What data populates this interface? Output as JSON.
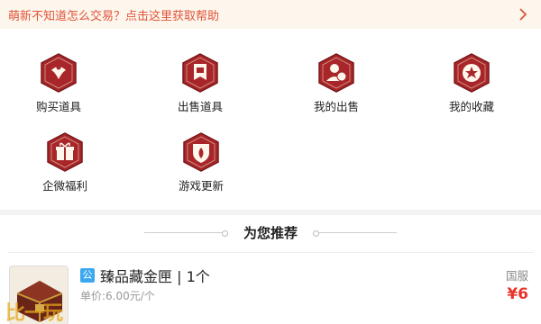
{
  "help_bar": {
    "text": "萌新不知道怎么交易？点击这里获取帮助",
    "icon": "chevron-right-icon"
  },
  "grid": {
    "items": [
      {
        "label": "购买道具",
        "icon": "buy-items-icon"
      },
      {
        "label": "出售道具",
        "icon": "sell-items-icon"
      },
      {
        "label": "我的出售",
        "icon": "my-sales-icon"
      },
      {
        "label": "我的收藏",
        "icon": "my-favorites-icon"
      },
      {
        "label": "企微福利",
        "icon": "gift-welfare-icon"
      },
      {
        "label": "游戏更新",
        "icon": "game-update-icon"
      }
    ]
  },
  "recommend": {
    "title": "为您推荐"
  },
  "product": {
    "badge": "公",
    "name": "臻品藏金匣 | 1个",
    "unit_price": "单价:6.00元/个",
    "server": "国服",
    "price": "¥6"
  },
  "watermark": "比一玩",
  "colors": {
    "accent": "#e0533a",
    "hex_fill": "#a8262a",
    "price": "#e8342a",
    "help_bg": "#fdf6ec"
  }
}
